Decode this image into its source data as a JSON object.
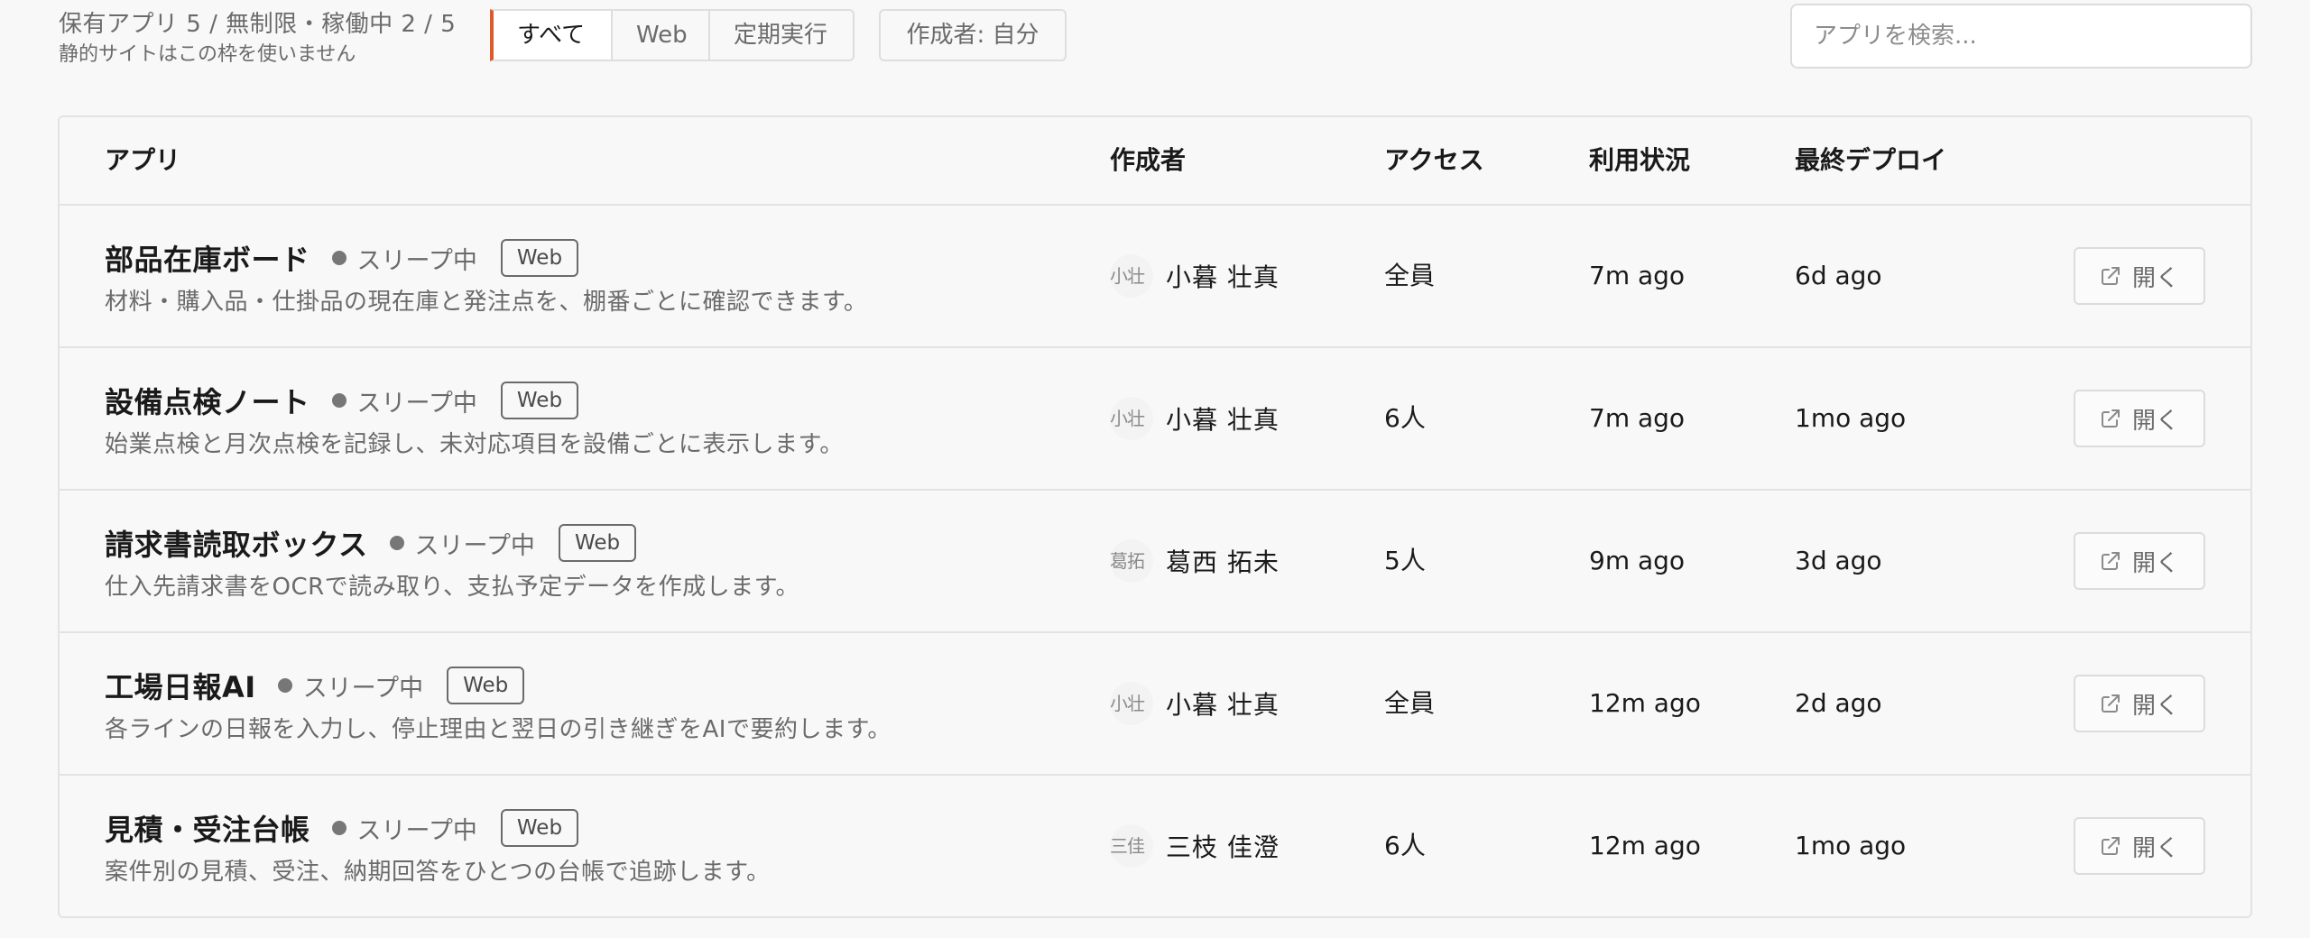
{
  "quota": {
    "line1": "保有アプリ 5 / 無制限・稼働中 2 / 5",
    "line2": "静的サイトはこの枠を使いません"
  },
  "filters": {
    "tabs": [
      {
        "label": "すべて"
      },
      {
        "label": "Web"
      },
      {
        "label": "定期実行"
      }
    ],
    "creator": "作成者: 自分",
    "accent_color": "#e0592a"
  },
  "search": {
    "placeholder": "アプリを検索...",
    "value": ""
  },
  "table": {
    "headers": {
      "app": "アプリ",
      "creator": "作成者",
      "access": "アクセス",
      "usage": "利用状況",
      "deploy": "最終デプロイ"
    },
    "rows": [
      {
        "name": "部品在庫ボード",
        "status": "スリープ中",
        "tag": "Web",
        "description": "材料・購入品・仕掛品の現在庫と発注点を、棚番ごとに確認できます。",
        "avatar": "小壮",
        "creator": "小暮 壮真",
        "access": "全員",
        "usage": "7m ago",
        "deploy": "6d ago",
        "open": "開く"
      },
      {
        "name": "設備点検ノート",
        "status": "スリープ中",
        "tag": "Web",
        "description": "始業点検と月次点検を記録し、未対応項目を設備ごとに表示します。",
        "avatar": "小壮",
        "creator": "小暮 壮真",
        "access": "6人",
        "usage": "7m ago",
        "deploy": "1mo ago",
        "open": "開く"
      },
      {
        "name": "請求書読取ボックス",
        "status": "スリープ中",
        "tag": "Web",
        "description": "仕入先請求書をOCRで読み取り、支払予定データを作成します。",
        "avatar": "葛拓",
        "creator": "葛西 拓未",
        "access": "5人",
        "usage": "9m ago",
        "deploy": "3d ago",
        "open": "開く"
      },
      {
        "name": "工場日報AI",
        "status": "スリープ中",
        "tag": "Web",
        "description": "各ラインの日報を入力し、停止理由と翌日の引き継ぎをAIで要約します。",
        "avatar": "小壮",
        "creator": "小暮 壮真",
        "access": "全員",
        "usage": "12m ago",
        "deploy": "2d ago",
        "open": "開く"
      },
      {
        "name": "見積・受注台帳",
        "status": "スリープ中",
        "tag": "Web",
        "description": "案件別の見積、受注、納期回答をひとつの台帳で追跡します。",
        "avatar": "三佳",
        "creator": "三枝 佳澄",
        "access": "6人",
        "usage": "12m ago",
        "deploy": "1mo ago",
        "open": "開く"
      }
    ]
  }
}
